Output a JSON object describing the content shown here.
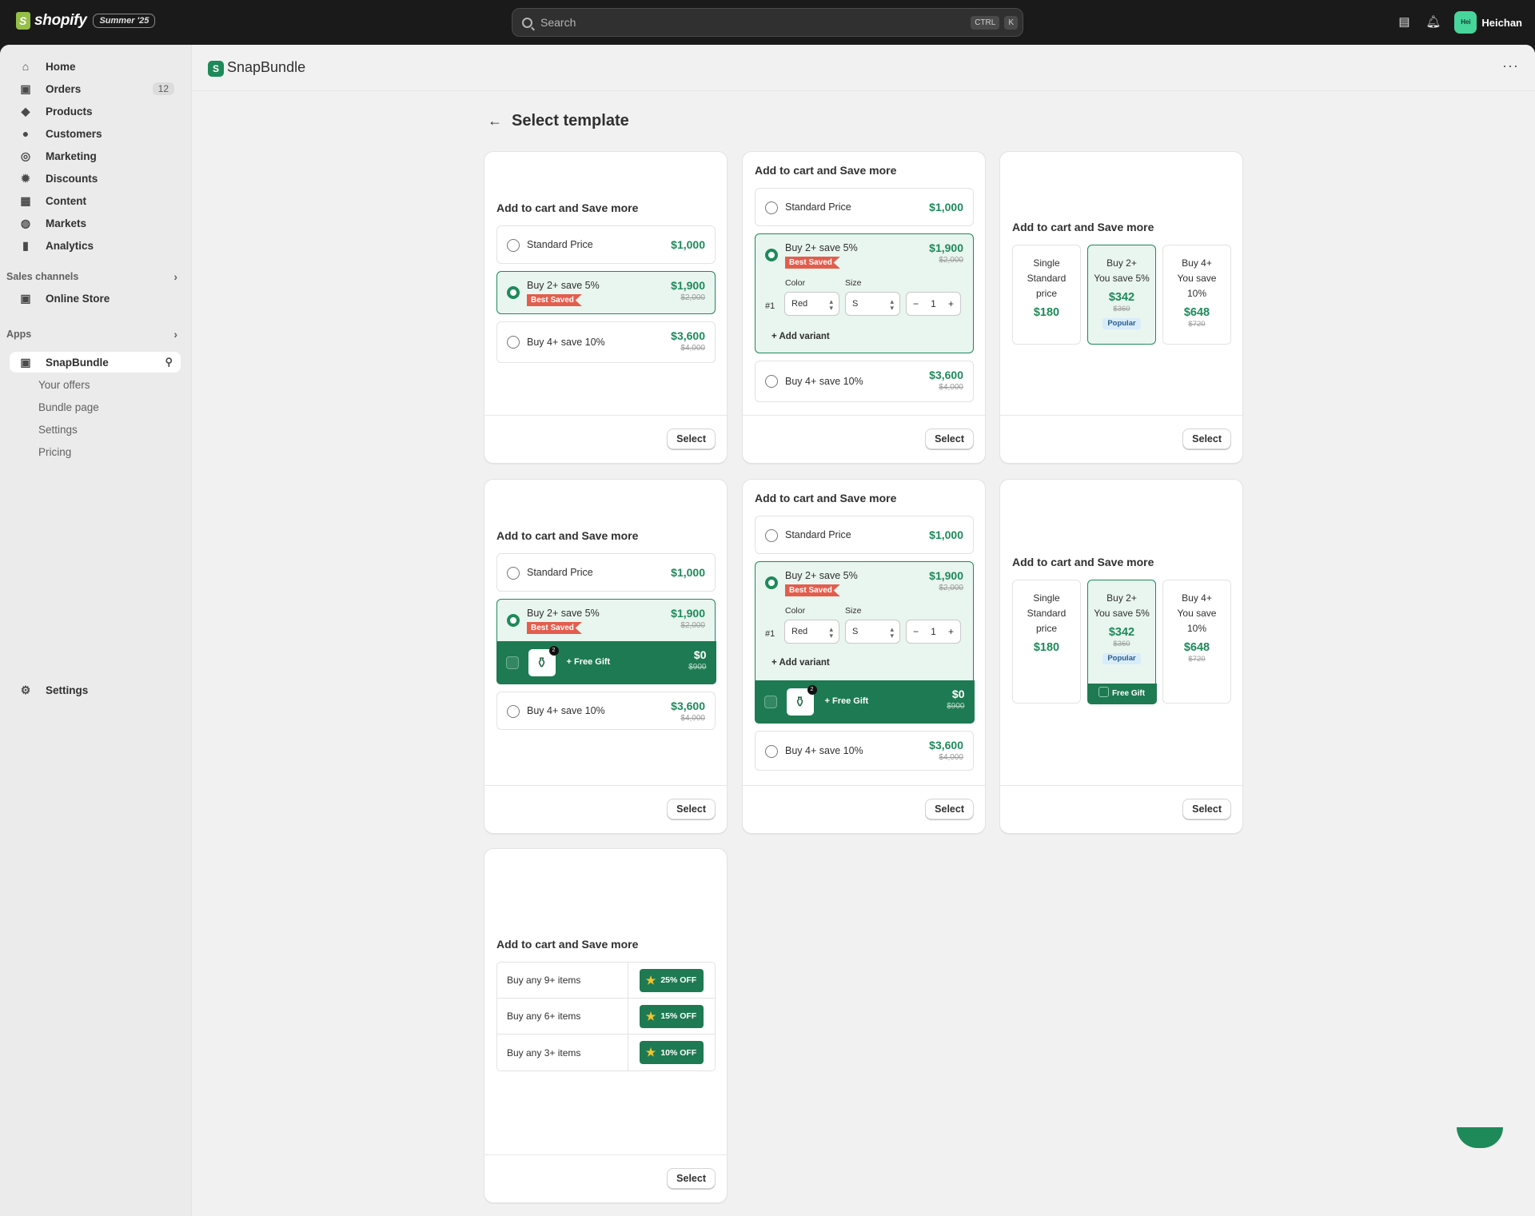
{
  "topbar": {
    "brand": "shopify",
    "edition": "Summer '25",
    "search_placeholder": "Search",
    "shortcut": [
      "CTRL",
      "K"
    ],
    "user": {
      "initials": "Hei",
      "name": "Heichan"
    }
  },
  "sidebar": {
    "items": [
      {
        "label": "Home",
        "icon": "home-icon"
      },
      {
        "label": "Orders",
        "icon": "orders-icon",
        "count": "12"
      },
      {
        "label": "Products",
        "icon": "tag-icon"
      },
      {
        "label": "Customers",
        "icon": "person-icon"
      },
      {
        "label": "Marketing",
        "icon": "target-icon"
      },
      {
        "label": "Discounts",
        "icon": "discount-icon"
      },
      {
        "label": "Content",
        "icon": "content-icon"
      },
      {
        "label": "Markets",
        "icon": "globe-icon"
      },
      {
        "label": "Analytics",
        "icon": "chart-icon"
      }
    ],
    "sales_channels": {
      "title": "Sales channels",
      "items": [
        "Online Store"
      ]
    },
    "apps": {
      "title": "Apps",
      "active": "SnapBundle",
      "sub_items": [
        "Your offers",
        "Bundle page",
        "Settings",
        "Pricing"
      ]
    },
    "settings": "Settings"
  },
  "app": {
    "name": "SnapBundle"
  },
  "page": {
    "title": "Select template",
    "select_label": "Select"
  },
  "widget": {
    "heading": "Add to cart and Save more",
    "options": [
      {
        "label": "Standard Price",
        "price": "$1,000"
      },
      {
        "label": "Buy 2+ save 5%",
        "price": "$1,900",
        "old": "$2,000",
        "tag": "Best Saved"
      },
      {
        "label": "Buy 4+ save 10%",
        "price": "$3,600",
        "old": "$4,000"
      }
    ],
    "variant": {
      "num": "#1",
      "color_label": "Color",
      "color": "Red",
      "size_label": "Size",
      "size": "S",
      "qty": "1",
      "add": "Add variant"
    },
    "gift": {
      "count": "2",
      "label": "+ Free Gift",
      "price": "$0",
      "old": "$900",
      "short": "Free Gift"
    },
    "tiers": [
      {
        "l1": "Single",
        "l2": "Standard",
        "l3": "price",
        "price": "$180"
      },
      {
        "l1": "Buy 2+",
        "l2": "You save 5%",
        "price": "$342",
        "old": "$360",
        "badge": "Popular"
      },
      {
        "l1": "Buy 4+",
        "l2": "You save",
        "l3": "10%",
        "price": "$648",
        "old": "$720"
      }
    ],
    "quantity_breaks": [
      {
        "label": "Buy any 9+ items",
        "off": "25% OFF"
      },
      {
        "label": "Buy any 6+ items",
        "off": "15% OFF"
      },
      {
        "label": "Buy any 3+ items",
        "off": "10% OFF"
      }
    ]
  }
}
